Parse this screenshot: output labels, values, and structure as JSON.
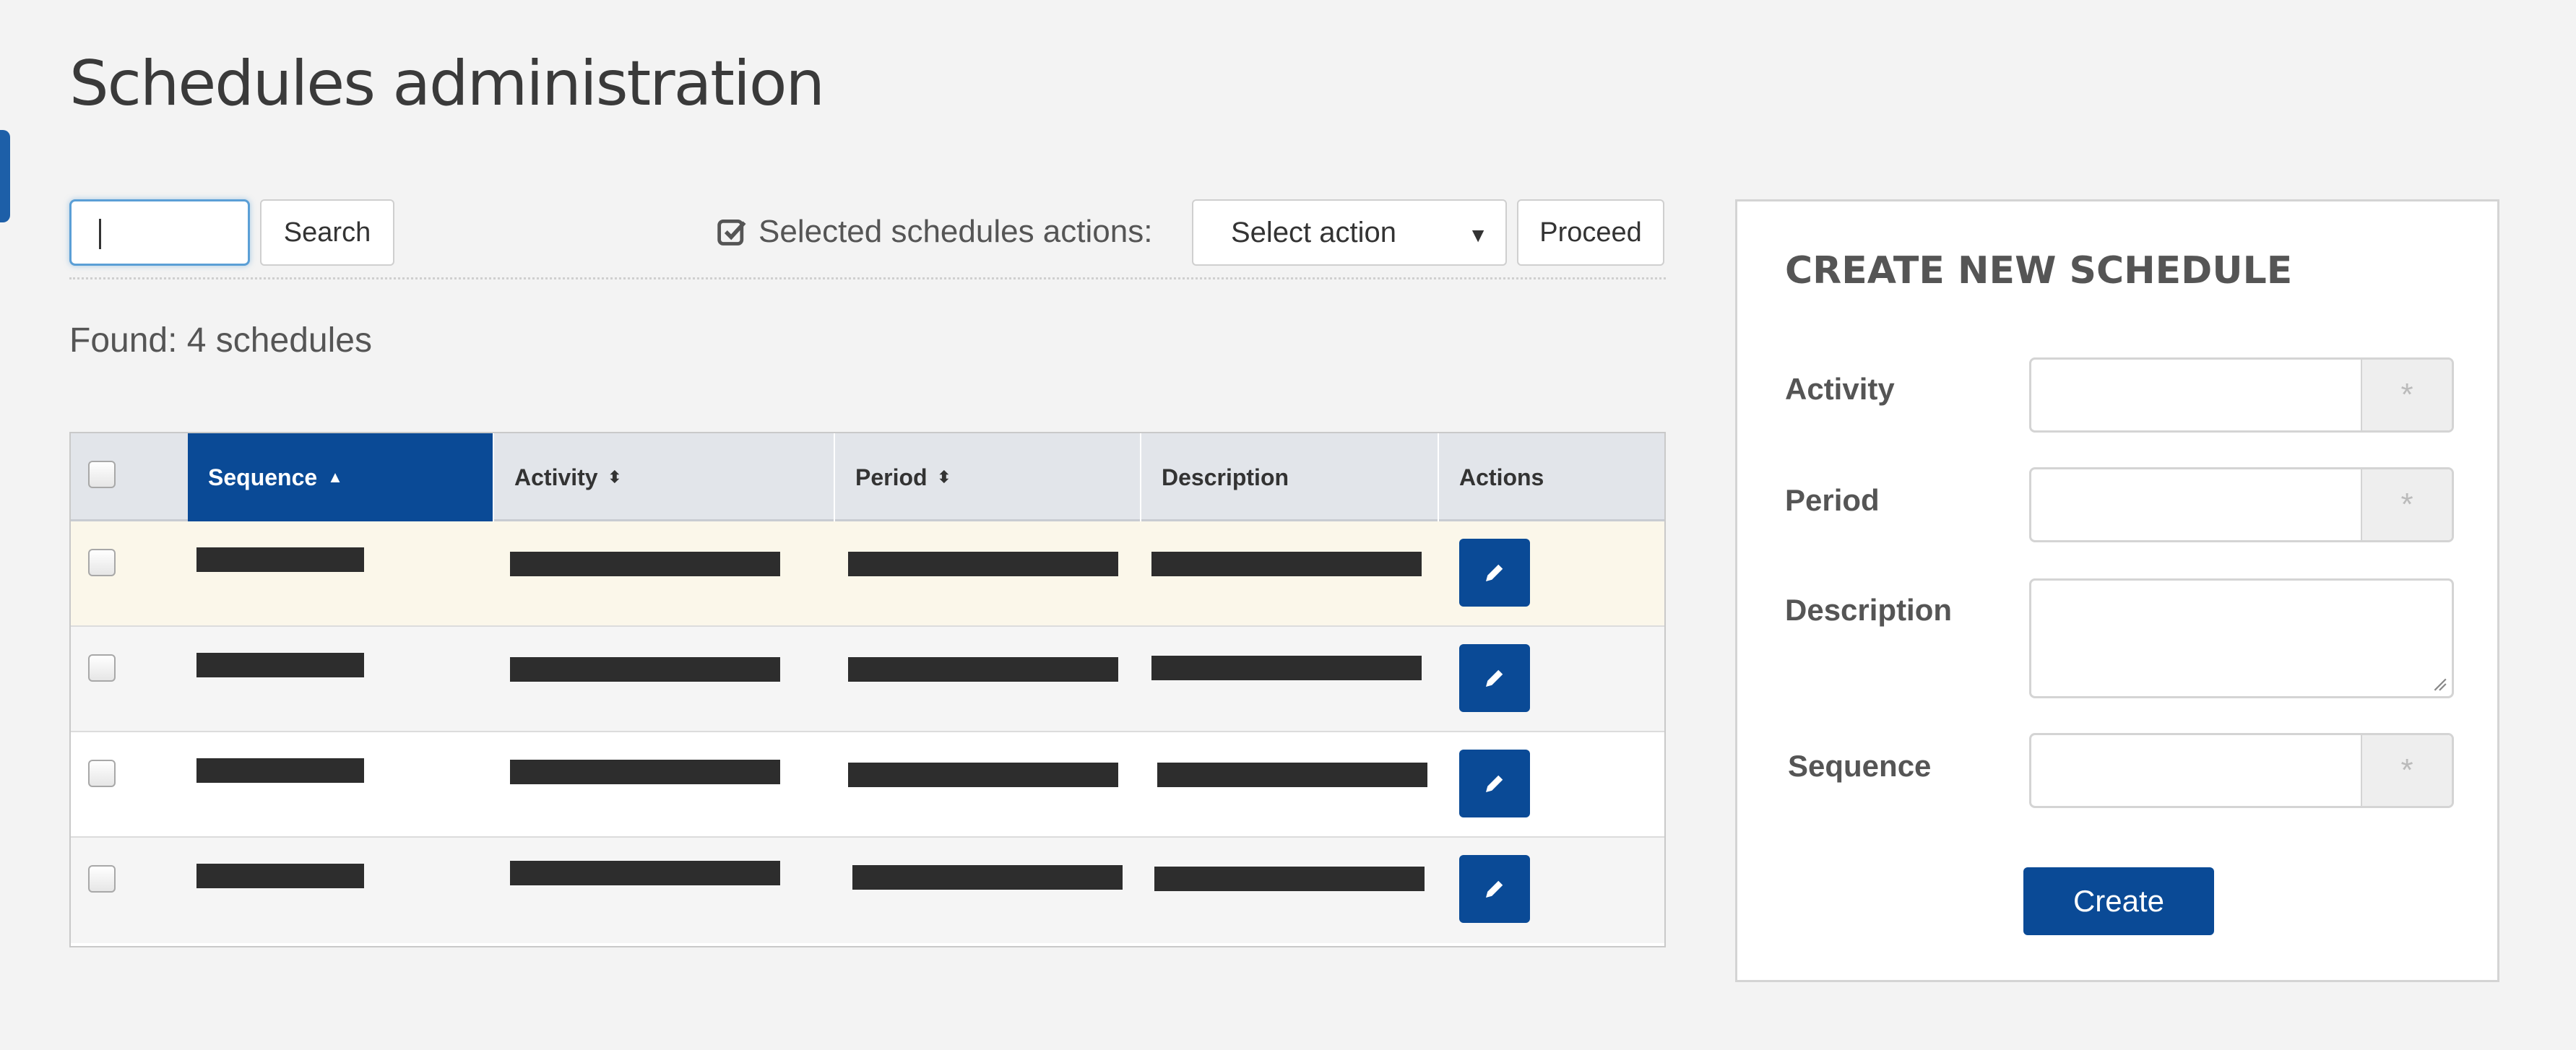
{
  "page": {
    "title": "Schedules administration"
  },
  "toolbar": {
    "search_value": "",
    "search_label": "Search",
    "selected_actions_label": "Selected schedules actions:",
    "select_action_value": "Select action",
    "proceed_label": "Proceed"
  },
  "found": {
    "text": "Found: 4 schedules"
  },
  "table": {
    "columns": [
      {
        "label": "Sequence",
        "sort": "ascending",
        "active": true
      },
      {
        "label": "Activity",
        "sort": "sortable",
        "active": false
      },
      {
        "label": "Period",
        "sort": "sortable",
        "active": false
      },
      {
        "label": "Description",
        "sort": "none",
        "active": false
      },
      {
        "label": "Actions",
        "sort": "none",
        "active": false
      }
    ],
    "rows": [
      {
        "sequence": "[redacted]",
        "activity": "[redacted]",
        "period": "[redacted]",
        "description": "[redacted]",
        "action": "edit-icon"
      },
      {
        "sequence": "[redacted]",
        "activity": "[redacted]",
        "period": "[redacted]",
        "description": "[redacted]",
        "action": "edit-icon"
      },
      {
        "sequence": "[redacted]",
        "activity": "[redacted]",
        "period": "[redacted]",
        "description": "[redacted]",
        "action": "edit-icon"
      },
      {
        "sequence": "[redacted]",
        "activity": "[redacted]",
        "period": "[redacted]",
        "description": "[redacted]",
        "action": "edit-icon"
      }
    ]
  },
  "create_panel": {
    "title": "CREATE NEW SCHEDULE",
    "fields": [
      {
        "label": "Activity",
        "value": "",
        "required_marker": "*"
      },
      {
        "label": "Period",
        "value": "",
        "required_marker": "*"
      },
      {
        "label": "Description",
        "value": ""
      },
      {
        "label": "Sequence",
        "value": "",
        "required_marker": "*"
      }
    ],
    "create_label": "Create"
  },
  "colors": {
    "primary": "#0a4a96",
    "background": "#f3f3f3",
    "header_bg": "#e2e5ea",
    "highlight_row": "#fbf7ea"
  }
}
